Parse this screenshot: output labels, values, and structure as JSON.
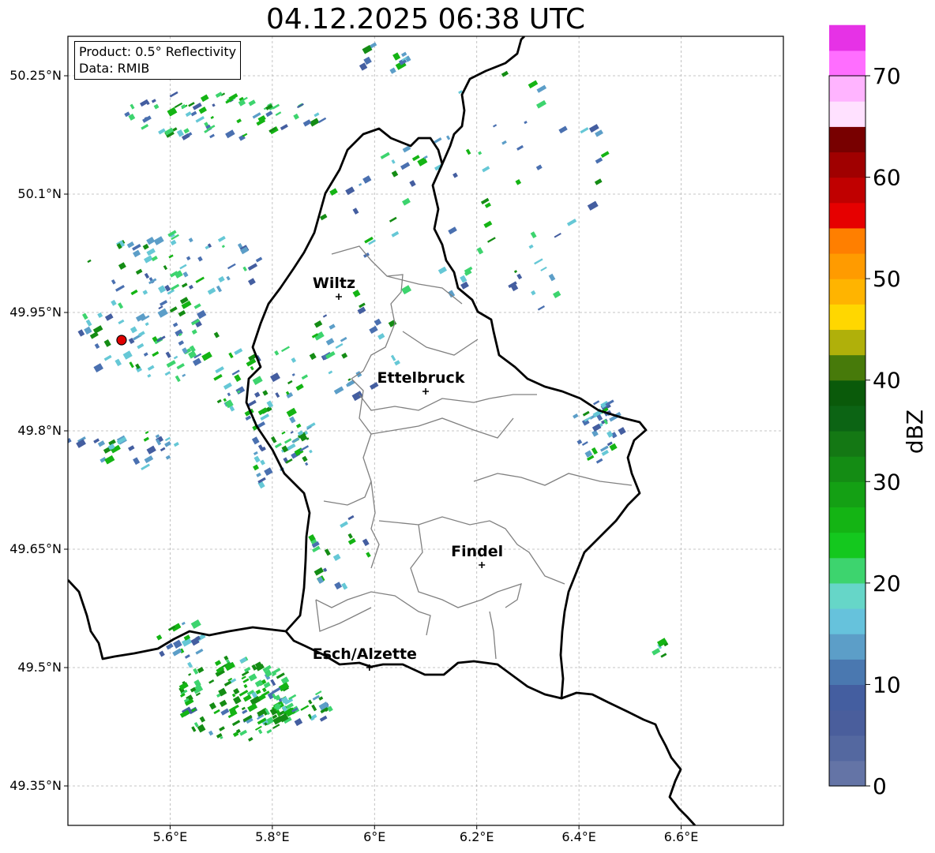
{
  "title": "04.12.2025 06:38 UTC",
  "info": {
    "product_line": "Product: 0.5° Reflectivity",
    "data_line": "Data: RMIB"
  },
  "map_extent": {
    "lon": [
      5.4,
      6.8
    ],
    "lat": [
      49.3,
      50.3
    ]
  },
  "lon_ticks": [
    "5.6°E",
    "5.8°E",
    "6°E",
    "6.2°E",
    "6.4°E",
    "6.6°E"
  ],
  "lat_ticks": [
    "50.25°N",
    "50.1°N",
    "49.95°N",
    "49.8°N",
    "49.65°N",
    "49.5°N",
    "49.35°N"
  ],
  "cities": [
    {
      "name": "Wiltz",
      "lon": 5.93,
      "lat": 49.97
    },
    {
      "name": "Ettelbruck",
      "lon": 6.1,
      "lat": 49.85
    },
    {
      "name": "Findel",
      "lon": 6.21,
      "lat": 49.63
    },
    {
      "name": "Esch/Alzette",
      "lon": 5.99,
      "lat": 49.5
    }
  ],
  "radar_site": {
    "lon": 5.505,
    "lat": 49.915,
    "color": "#e00000"
  },
  "colorbar": {
    "label": "dBZ",
    "ticks": [
      "0",
      "10",
      "20",
      "30",
      "40",
      "50",
      "60",
      "70"
    ],
    "min": 0,
    "max": 70,
    "step": 2.5,
    "colors": [
      "#6474a6",
      "#5468a0",
      "#4a5e9c",
      "#445ea0",
      "#4a78b0",
      "#5c9ec8",
      "#66c2dc",
      "#66d6c8",
      "#3dd46e",
      "#14c81e",
      "#14b414",
      "#14a014",
      "#148c14",
      "#147814",
      "#0c6414",
      "#0a5a0a",
      "#477a0a",
      "#b0b00a",
      "#ffd700",
      "#ffb400",
      "#ff9b00",
      "#ff7f00",
      "#e60000",
      "#c00000",
      "#a00000",
      "#780000",
      "#ffe1ff",
      "#ffb4ff",
      "#ff6eff",
      "#e632e6"
    ]
  },
  "echo_colors": [
    "#4a70b0",
    "#5c9ec8",
    "#66c8d6",
    "#3dd46e",
    "#14b414",
    "#148c14",
    "#445ea0"
  ],
  "echo_clusters": [
    {
      "lon": 5.72,
      "lat": 49.46,
      "dlon": 0.11,
      "dlat": 0.055,
      "n": 130,
      "strength": 0.8
    },
    {
      "lon": 5.85,
      "lat": 49.45,
      "dlon": 0.07,
      "dlat": 0.02,
      "n": 30,
      "strength": 0.6
    },
    {
      "lon": 5.8,
      "lat": 49.78,
      "dlon": 0.08,
      "dlat": 0.05,
      "n": 45,
      "strength": 0.45
    },
    {
      "lon": 5.77,
      "lat": 49.86,
      "dlon": 0.09,
      "dlat": 0.05,
      "n": 40,
      "strength": 0.45
    },
    {
      "lon": 5.55,
      "lat": 49.92,
      "dlon": 0.14,
      "dlat": 0.06,
      "n": 70,
      "strength": 0.35
    },
    {
      "lon": 5.6,
      "lat": 50.01,
      "dlon": 0.18,
      "dlat": 0.04,
      "n": 55,
      "strength": 0.35
    },
    {
      "lon": 5.7,
      "lat": 50.2,
      "dlon": 0.2,
      "dlat": 0.03,
      "n": 70,
      "strength": 0.45
    },
    {
      "lon": 5.5,
      "lat": 49.78,
      "dlon": 0.12,
      "dlat": 0.03,
      "n": 30,
      "strength": 0.25
    },
    {
      "lon": 6.43,
      "lat": 49.8,
      "dlon": 0.05,
      "dlat": 0.04,
      "n": 35,
      "strength": 0.2
    },
    {
      "lon": 5.96,
      "lat": 49.9,
      "dlon": 0.1,
      "dlat": 0.06,
      "n": 30,
      "strength": 0.4
    },
    {
      "lon": 6.05,
      "lat": 50.06,
      "dlon": 0.18,
      "dlat": 0.1,
      "n": 35,
      "strength": 0.35
    },
    {
      "lon": 6.28,
      "lat": 50.15,
      "dlon": 0.18,
      "dlat": 0.12,
      "n": 30,
      "strength": 0.35
    },
    {
      "lon": 5.93,
      "lat": 49.65,
      "dlon": 0.07,
      "dlat": 0.05,
      "n": 18,
      "strength": 0.2
    },
    {
      "lon": 6.01,
      "lat": 50.27,
      "dlon": 0.05,
      "dlat": 0.02,
      "n": 12,
      "strength": 0.3
    },
    {
      "lon": 5.62,
      "lat": 49.53,
      "dlon": 0.05,
      "dlat": 0.03,
      "n": 18,
      "strength": 0.5
    },
    {
      "lon": 6.55,
      "lat": 49.53,
      "dlon": 0.02,
      "dlat": 0.02,
      "n": 6,
      "strength": 0.6
    },
    {
      "lon": 6.3,
      "lat": 49.98,
      "dlon": 0.05,
      "dlat": 0.04,
      "n": 10,
      "strength": 0.5
    }
  ]
}
